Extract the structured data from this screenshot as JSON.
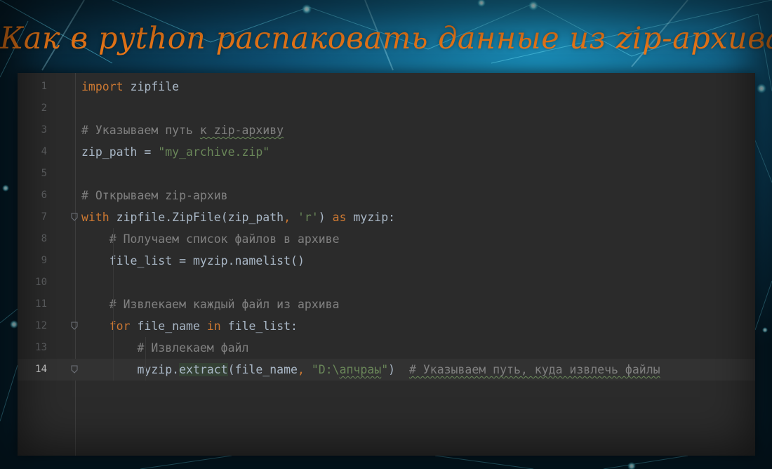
{
  "title": "Как  в python распаковать данные из zip-архива",
  "editor": {
    "lines": [
      {
        "n": "1",
        "parts": [
          {
            "t": "import",
            "c": "kw"
          },
          {
            "t": " zipfile",
            "c": "id"
          }
        ]
      },
      {
        "n": "2",
        "parts": []
      },
      {
        "n": "3",
        "parts": [
          {
            "t": "# Указываем путь ",
            "c": "cm"
          },
          {
            "t": "к zip-архиву",
            "c": "cm wavy"
          }
        ]
      },
      {
        "n": "4",
        "parts": [
          {
            "t": "zip_path = ",
            "c": "id"
          },
          {
            "t": "\"my_archive.zip\"",
            "c": "str"
          }
        ]
      },
      {
        "n": "5",
        "parts": []
      },
      {
        "n": "6",
        "parts": [
          {
            "t": "# Открываем zip-архив",
            "c": "cm"
          }
        ]
      },
      {
        "n": "7",
        "parts": [
          {
            "t": "with",
            "c": "kw"
          },
          {
            "t": " zipfile.ZipFile(zip_path",
            "c": "id"
          },
          {
            "t": ", ",
            "c": "kw"
          },
          {
            "t": "'r'",
            "c": "str"
          },
          {
            "t": ") ",
            "c": "id"
          },
          {
            "t": "as",
            "c": "kw"
          },
          {
            "t": " myzip:",
            "c": "id"
          }
        ]
      },
      {
        "n": "8",
        "parts": [
          {
            "t": "    # Получаем список файлов в архиве",
            "c": "cm"
          }
        ]
      },
      {
        "n": "9",
        "parts": [
          {
            "t": "    file_list = myzip.namelist()",
            "c": "id"
          }
        ]
      },
      {
        "n": "10",
        "parts": []
      },
      {
        "n": "11",
        "parts": [
          {
            "t": "    # Извлекаем каждый файл из архива",
            "c": "cm"
          }
        ]
      },
      {
        "n": "12",
        "parts": [
          {
            "t": "    ",
            "c": "id"
          },
          {
            "t": "for",
            "c": "kw"
          },
          {
            "t": " file_name ",
            "c": "id"
          },
          {
            "t": "in",
            "c": "kw"
          },
          {
            "t": " file_list:",
            "c": "id"
          }
        ]
      },
      {
        "n": "13",
        "parts": [
          {
            "t": "        # Извлекаем файл",
            "c": "cm"
          }
        ]
      },
      {
        "n": "14",
        "parts": [
          {
            "t": "        myzip.",
            "c": "id"
          },
          {
            "t": "extract",
            "c": "ext"
          },
          {
            "t": "(file_name",
            "c": "id"
          },
          {
            "t": ", ",
            "c": "kw"
          },
          {
            "t": "\"D:\\",
            "c": "str"
          },
          {
            "t": "апчраы",
            "c": "str wavy"
          },
          {
            "t": "\"",
            "c": "str"
          },
          {
            "t": ")  ",
            "c": "id"
          },
          {
            "t": "# Указываем путь, куда извлечь файлы",
            "c": "cm wavy"
          }
        ]
      }
    ],
    "current_line": "14",
    "fold_markers": [
      "7",
      "12",
      "14"
    ]
  },
  "colors": {
    "keyword": "#cc7832",
    "string": "#6a8759",
    "comment": "#808080",
    "identifier": "#a9b7c6",
    "title": "#f07a18",
    "editor_bg": "#2b2b2b"
  }
}
